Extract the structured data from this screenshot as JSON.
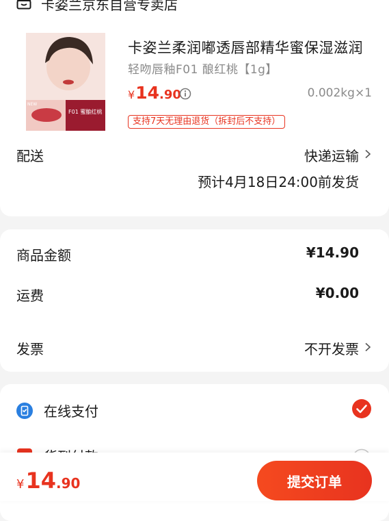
{
  "store": {
    "name": "卡姿兰京东自营专卖店",
    "icon": "store-icon"
  },
  "product": {
    "title": "卡姿兰柔润嘟透唇部精华蜜保湿滋润",
    "spec": "轻吻唇釉F01 酿红桃【1g】",
    "price_symbol": "¥",
    "price_int": "14",
    "price_dec": ".90",
    "weight": "0.002kg",
    "quantity": "×1",
    "return_policy": "支持7天无理由退货（拆封后不支持）",
    "image_badge": "F01 蜜酿红桃",
    "image_tag": "NEW"
  },
  "shipping": {
    "label": "配送",
    "method": "快递运输",
    "eta": "预计4月18日24:00前发货"
  },
  "amounts": {
    "goods_label": "商品金额",
    "goods_value": "¥14.90",
    "freight_label": "运费",
    "freight_value": "¥0.00",
    "invoice_label": "发票",
    "invoice_value": "不开发票"
  },
  "payment": {
    "online_label": "在线支付",
    "cod_label": "货到付款"
  },
  "footer": {
    "total_symbol": "¥",
    "total_int": "14",
    "total_dec": ".90",
    "submit_label": "提交订单"
  },
  "colors": {
    "accent": "#e8331f",
    "pay_blue": "#2a7fe0"
  }
}
